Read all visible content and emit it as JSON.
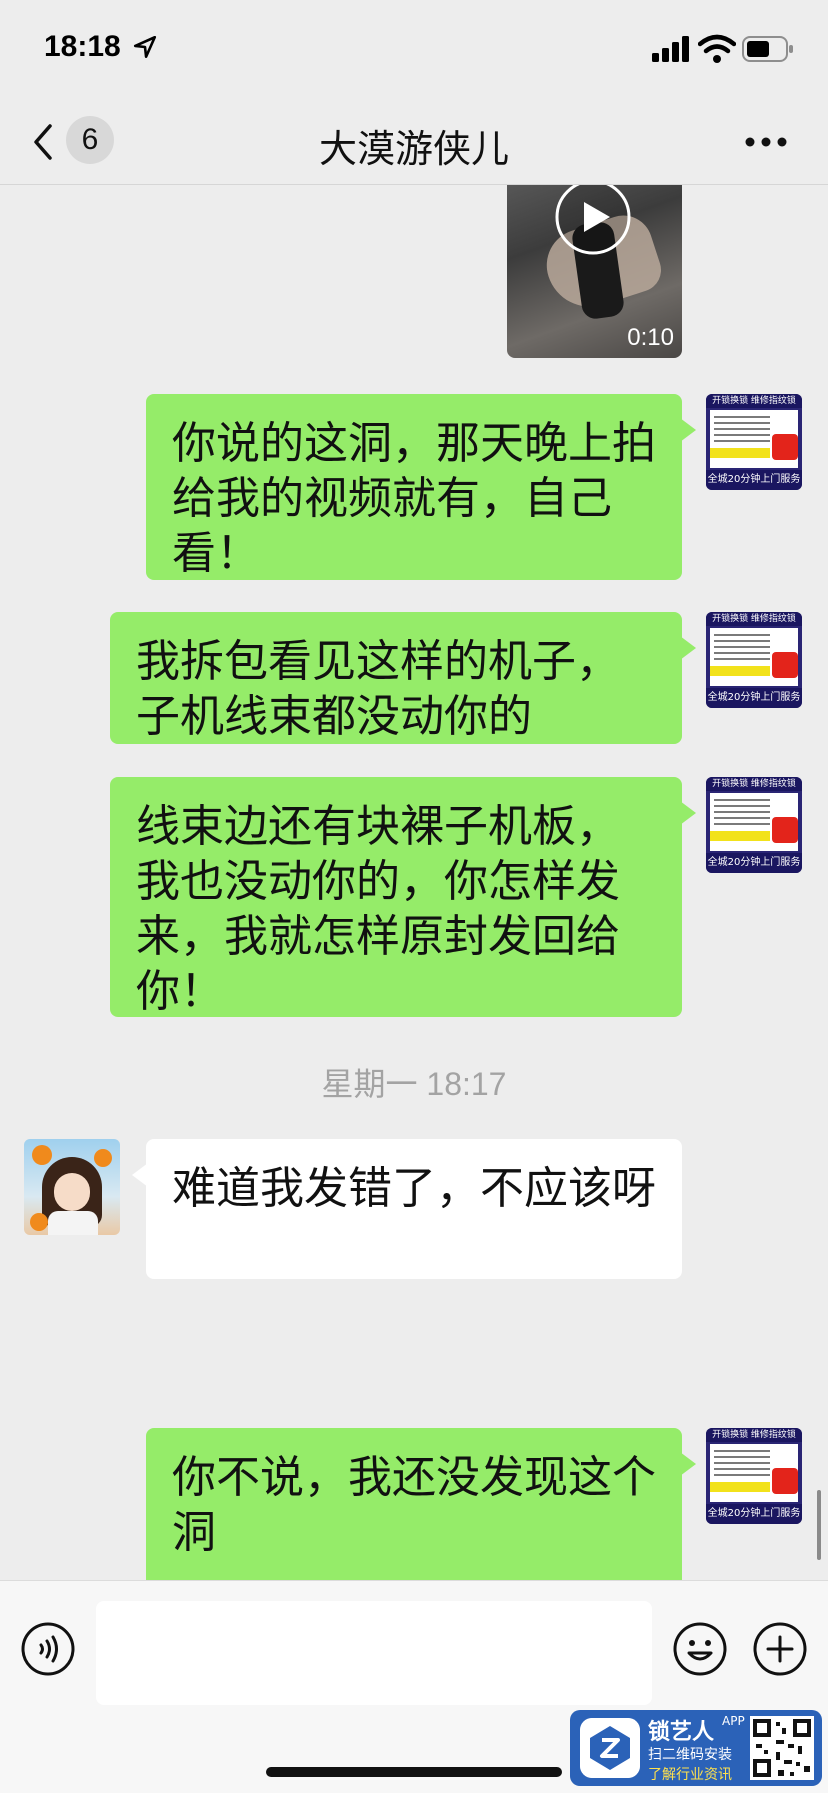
{
  "status_bar": {
    "time": "18:18"
  },
  "nav": {
    "unread_count": "6",
    "title": "大漠游侠儿"
  },
  "video_message": {
    "duration": "0:10"
  },
  "messages": [
    {
      "sender": "me",
      "text": "你说的这洞，那天晚上拍给我的视频就有，自己看！"
    },
    {
      "sender": "me",
      "text": "我拆包看见这样的机子，子机线束都没动你的"
    },
    {
      "sender": "me",
      "text": "线束边还有块裸子机板，我也没动你的，你怎样发来，我就怎样原封发回给你！"
    },
    {
      "sender": "other",
      "text": "难道我发错了，不应该呀"
    },
    {
      "sender": "me",
      "text": "你不说，我还没发现这个洞"
    }
  ],
  "timestamp": "星期一 18:17",
  "my_avatar": {
    "top": "开锁换锁 维修指纹锁",
    "bottom": "全城20分钟上门服务"
  },
  "input": {
    "placeholder": ""
  },
  "watermark": {
    "title": "锁艺人",
    "app": "APP",
    "line1": "扫二维码安装",
    "line2": "了解行业资讯"
  },
  "colors": {
    "my_bubble": "#95ec69",
    "their_bubble": "#ffffff",
    "background": "#ededed"
  }
}
